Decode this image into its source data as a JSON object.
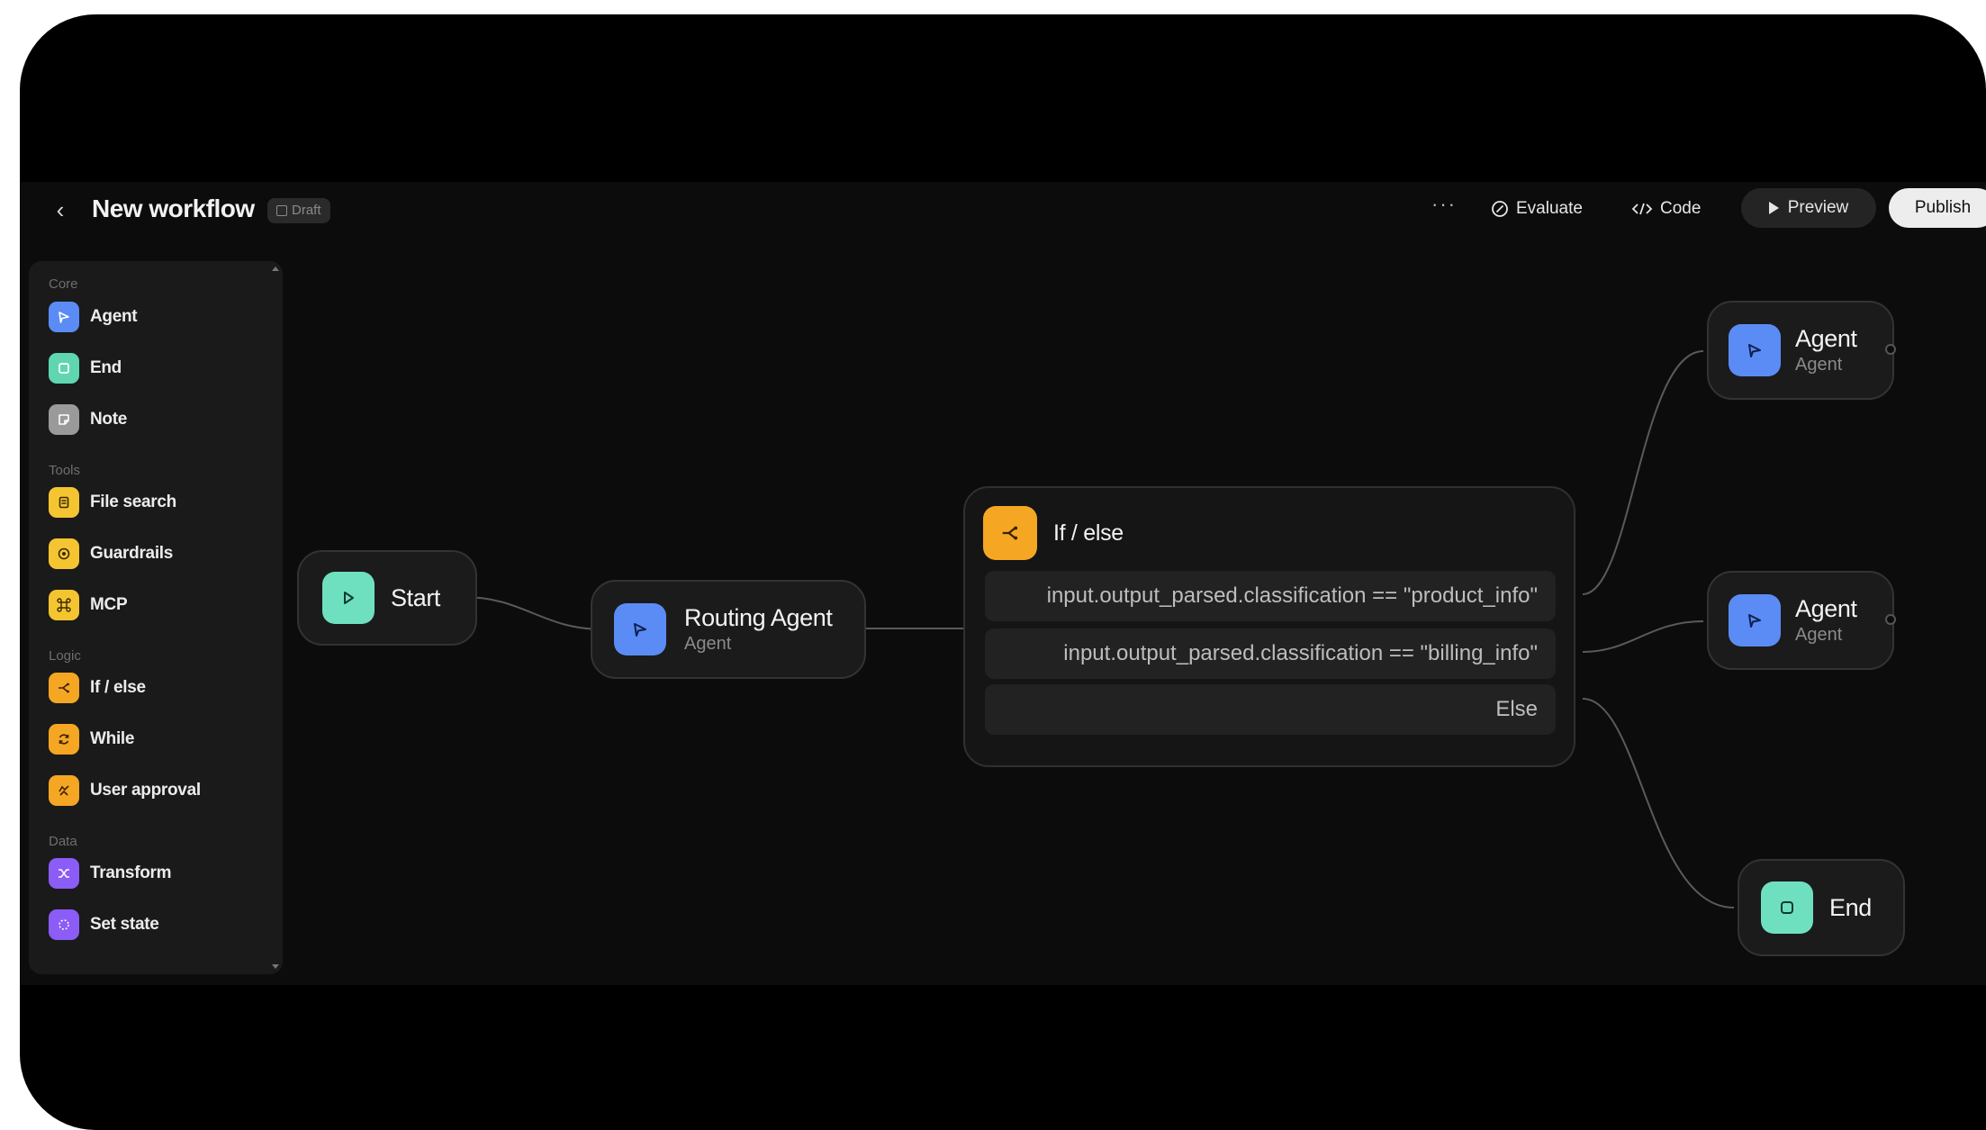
{
  "header": {
    "back_icon": "chevron-left-icon",
    "title": "New workflow",
    "badge": "Draft",
    "more": "···",
    "evaluate": "Evaluate",
    "code": "Code",
    "preview": "Preview",
    "publish": "Publish"
  },
  "sidebar": {
    "sections": [
      {
        "label": "Core",
        "items": [
          {
            "label": "Agent",
            "icon": "agent-icon",
            "color": "#5b8cf5"
          },
          {
            "label": "End",
            "icon": "end-icon",
            "color": "#5fd6b0"
          },
          {
            "label": "Note",
            "icon": "note-icon",
            "color": "#9a9a9a"
          }
        ]
      },
      {
        "label": "Tools",
        "items": [
          {
            "label": "File search",
            "icon": "file-search-icon",
            "color": "#f5c531"
          },
          {
            "label": "Guardrails",
            "icon": "guardrails-icon",
            "color": "#f5c531"
          },
          {
            "label": "MCP",
            "icon": "mcp-icon",
            "color": "#f5c531"
          }
        ]
      },
      {
        "label": "Logic",
        "items": [
          {
            "label": "If / else",
            "icon": "if-else-icon",
            "color": "#f5a623"
          },
          {
            "label": "While",
            "icon": "while-icon",
            "color": "#f5a623"
          },
          {
            "label": "User approval",
            "icon": "user-approval-icon",
            "color": "#f5a623"
          }
        ]
      },
      {
        "label": "Data",
        "items": [
          {
            "label": "Transform",
            "icon": "transform-icon",
            "color": "#8b5cf6"
          },
          {
            "label": "Set state",
            "icon": "set-state-icon",
            "color": "#8b5cf6"
          }
        ]
      }
    ]
  },
  "canvas": {
    "start": {
      "title": "Start",
      "color": "#6fe0bf"
    },
    "routing": {
      "title": "Routing Agent",
      "subtitle": "Agent",
      "color": "#5b8cf5"
    },
    "ifelse": {
      "title": "If / else",
      "color": "#f5a623",
      "conditions": [
        "input.output_parsed.classification == \"product_info\"",
        "input.output_parsed.classification == \"billing_info\"",
        "Else"
      ]
    },
    "agent1": {
      "title": "Agent",
      "subtitle": "Agent",
      "color": "#5b8cf5"
    },
    "agent2": {
      "title": "Agent",
      "subtitle": "Agent",
      "color": "#5b8cf5"
    },
    "end": {
      "title": "End",
      "color": "#6fe0bf"
    }
  }
}
